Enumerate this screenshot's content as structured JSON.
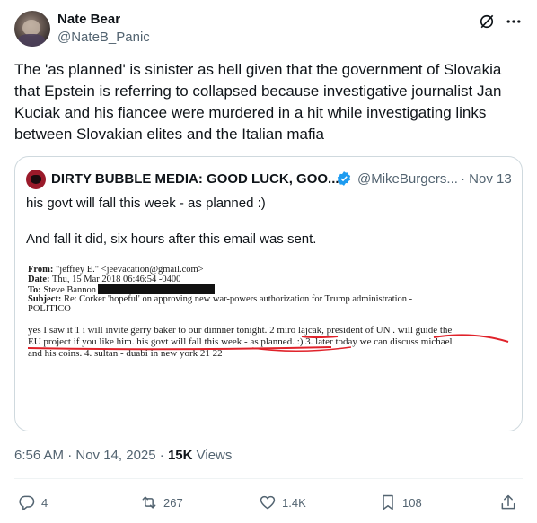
{
  "author": {
    "name": "Nate Bear",
    "handle": "@NateB_Panic"
  },
  "tweet": {
    "text": "The 'as planned' is sinister as hell given that the government of Slovakia that Epstein is referring to collapsed because investigative journalist Jan Kuciak and his fiancee were murdered in a hit while investigating links between Slovakian elites and the Italian mafia"
  },
  "quote": {
    "name": "DIRTY BUBBLE MEDIA: GOOD LUCK, GOO...",
    "handle": "@MikeBurgers...",
    "date": "· Nov 13",
    "line1": "his govt will fall this week - as planned :)",
    "line2": "And fall it did, six hours after this email was sent.",
    "email": {
      "from_label": "From:",
      "from_value": "\"jeffrey E.\" <jeevacation@gmail.com>",
      "date_label": "Date:",
      "date_value": "Thu, 15 Mar 2018 06:46:54 -0400",
      "to_label": "To:",
      "to_value": "Steve Bannon",
      "subject_label": "Subject:",
      "subject_value": "Re: Corker 'hopeful' on approving new war-powers authorization for Trump administration -",
      "subject_value2": "POLITICO",
      "body1": "yes I saw it   1  i will invite gerry baker to our dinnner tonight. 2  miro lajcak,  president of UN .   will guide the",
      "body2": "EU project if you like him. his govt will fall this week  - as planned. :)  3.  later today we can discuss michael",
      "body3": "and his coins.  4.  sultan - duabi in new york 21 22"
    }
  },
  "meta": {
    "time": "6:56 AM · Nov 14, 2025 · ",
    "views_count": "15K",
    "views_label": " Views"
  },
  "actions": {
    "replies": "4",
    "reposts": "267",
    "likes": "1.4K",
    "bookmarks": "108"
  },
  "colors": {
    "text": "#0f1419",
    "secondary": "#536471",
    "border": "#cfd9de",
    "verified": "#1d9bf0",
    "underline": "#e0222a"
  }
}
